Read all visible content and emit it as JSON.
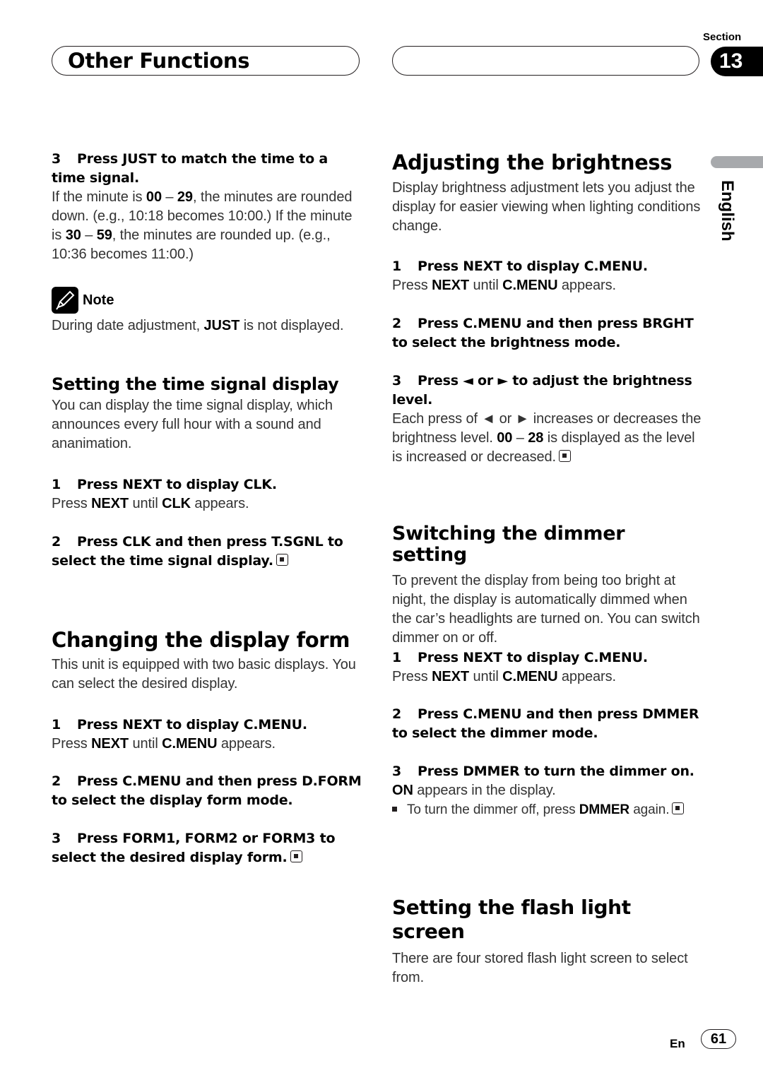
{
  "header": {
    "chapter_title": "Other Functions",
    "section_label": "Section",
    "section_number": "13",
    "language_tab": "English"
  },
  "left_column": {
    "step3_time": {
      "num": "3",
      "title": "Press JUST to match the time to a time signal.",
      "body_parts": [
        {
          "t": "If the minute is "
        },
        {
          "b": "00"
        },
        {
          "t": " – "
        },
        {
          "b": "29"
        },
        {
          "t": ", the minutes are rounded down. (e.g., 10:18 becomes 10:00.) If the minute is "
        },
        {
          "b": "30"
        },
        {
          "t": " – "
        },
        {
          "b": "59"
        },
        {
          "t": ", the minutes are rounded up. (e.g., 10:36 becomes 11:00.)"
        }
      ]
    },
    "note": {
      "icon": "pencil-note-icon",
      "label": "Note",
      "text_pre": "During date adjustment, ",
      "text_bold": "JUST",
      "text_post": " is not displayed."
    },
    "time_signal": {
      "heading": "Setting the time signal display",
      "intro": "You can display the time signal display, which announces every full hour with a sound and ananimation.",
      "step1": {
        "num": "1",
        "title": "Press NEXT to display CLK.",
        "body": {
          "pre": "Press ",
          "b1": "NEXT",
          "mid": " until ",
          "b2": "CLK",
          "post": " appears."
        }
      },
      "step2": {
        "num": "2",
        "title": "Press CLK and then press T.SGNL to select the time signal display."
      }
    },
    "display_form": {
      "heading": "Changing the display form",
      "intro": "This unit is equipped with two basic displays. You can select the desired display.",
      "step1": {
        "num": "1",
        "title": "Press NEXT to display C.MENU.",
        "body": {
          "pre": "Press ",
          "b1": "NEXT",
          "mid": " until ",
          "b2": "C.MENU",
          "post": " appears."
        }
      },
      "step2": {
        "num": "2",
        "title": "Press C.MENU and then press D.FORM to select the display form mode."
      },
      "step3": {
        "num": "3",
        "title": "Press FORM1, FORM2 or FORM3 to select the desired display form."
      }
    }
  },
  "right_column": {
    "brightness": {
      "heading": "Adjusting the brightness",
      "intro": "Display brightness adjustment lets you adjust the display for easier viewing when lighting conditions change.",
      "step1": {
        "num": "1",
        "title": "Press NEXT to display C.MENU.",
        "body": {
          "pre": "Press ",
          "b1": "NEXT",
          "mid": " until ",
          "b2": "C.MENU",
          "post": " appears."
        }
      },
      "step2": {
        "num": "2",
        "title": "Press C.MENU and then press BRGHT to select the brightness mode."
      },
      "step3": {
        "num": "3",
        "title": "Press ◄ or ► to adjust the brightness level.",
        "body_pre": "Each press of ◄ or ► increases or decreases the brightness level. ",
        "b1": "00",
        "dash": " – ",
        "b2": "28",
        "body_post": " is displayed as the level is increased or decreased."
      }
    },
    "dimmer": {
      "heading": "Switching the dimmer setting",
      "intro": "To prevent the display from being too bright at night, the display is automatically dimmed when the car’s headlights are turned on. You can switch dimmer on or off.",
      "step1": {
        "num": "1",
        "title": "Press NEXT to display C.MENU.",
        "body": {
          "pre": "Press ",
          "b1": "NEXT",
          "mid": " until ",
          "b2": "C.MENU",
          "post": " appears."
        }
      },
      "step2": {
        "num": "2",
        "title": "Press C.MENU and then press DMMER to select the dimmer mode."
      },
      "step3": {
        "num": "3",
        "title": "Press DMMER to turn the dimmer on.",
        "body_bold": "ON",
        "body_post": " appears in the display.",
        "bullet_pre": "To turn the dimmer off, press ",
        "bullet_bold": "DMMER",
        "bullet_post": " again."
      }
    },
    "flash": {
      "heading": "Setting the flash light screen",
      "intro": "There are four stored flash light screen to select from."
    }
  },
  "footer": {
    "lang_code": "En",
    "page_number": "61"
  }
}
